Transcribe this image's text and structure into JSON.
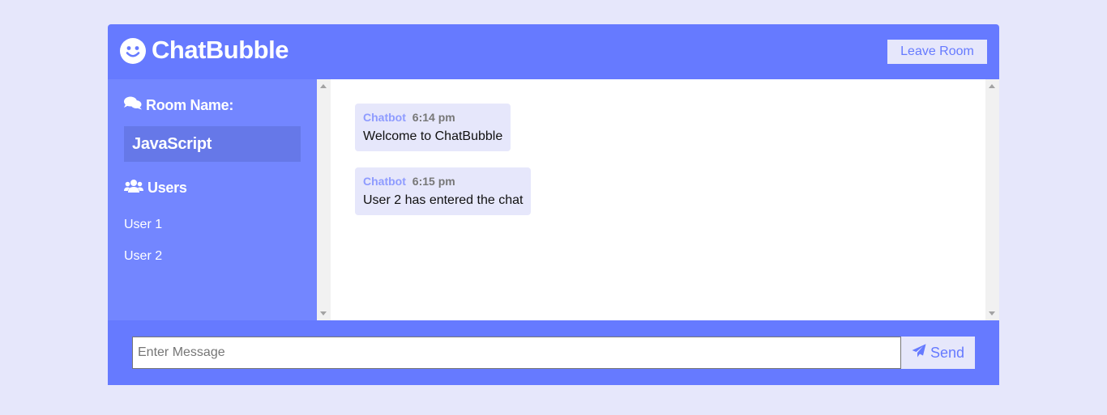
{
  "header": {
    "logo_icon": "smile-icon",
    "title": "ChatBubble",
    "leave_label": "Leave Room"
  },
  "sidebar": {
    "room_heading": "Room Name:",
    "room_heading_icon": "comments-icon",
    "room_name": "JavaScript",
    "users_heading": "Users",
    "users_heading_icon": "users-icon",
    "users": [
      "User 1",
      "User 2"
    ]
  },
  "messages": [
    {
      "author": "Chatbot",
      "time": "6:14 pm",
      "text": "Welcome to ChatBubble"
    },
    {
      "author": "Chatbot",
      "time": "6:15 pm",
      "text": "User 2 has entered the chat"
    }
  ],
  "composer": {
    "placeholder": "Enter Message",
    "value": "",
    "send_label": "Send",
    "send_icon": "paper-plane-icon"
  },
  "colors": {
    "page_background": "#e6e7fb",
    "primary": "#667aff",
    "sidebar": "#7386ff",
    "room_box": "#6678e8",
    "message_bubble": "#e6e7fb",
    "author": "#8e9bff"
  }
}
